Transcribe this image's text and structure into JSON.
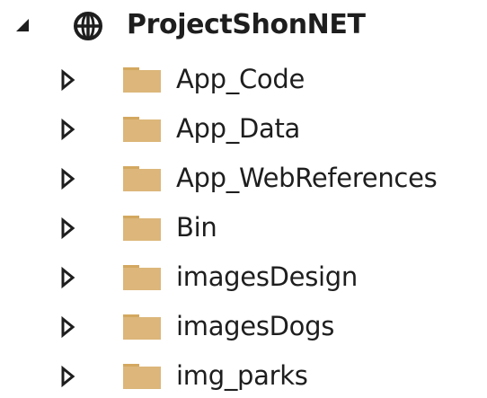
{
  "solution_explorer": {
    "project": {
      "name": "ProjectShonNET",
      "icon": "globe-icon",
      "expanded": true
    },
    "folders": [
      {
        "label": "App_Code",
        "icon": "folder-icon",
        "expanded": false
      },
      {
        "label": "App_Data",
        "icon": "folder-icon",
        "expanded": false
      },
      {
        "label": "App_WebReferences",
        "icon": "folder-icon",
        "expanded": false
      },
      {
        "label": "Bin",
        "icon": "folder-icon",
        "expanded": false
      },
      {
        "label": "imagesDesign",
        "icon": "folder-icon",
        "expanded": false
      },
      {
        "label": "imagesDogs",
        "icon": "folder-icon",
        "expanded": false
      },
      {
        "label": "img_parks",
        "icon": "folder-icon",
        "expanded": false
      }
    ],
    "colors": {
      "folder_fill": "#dcb67a",
      "folder_tab": "#d3a85f",
      "text": "#1e1e1e",
      "expander": "#1e1e1e"
    }
  }
}
